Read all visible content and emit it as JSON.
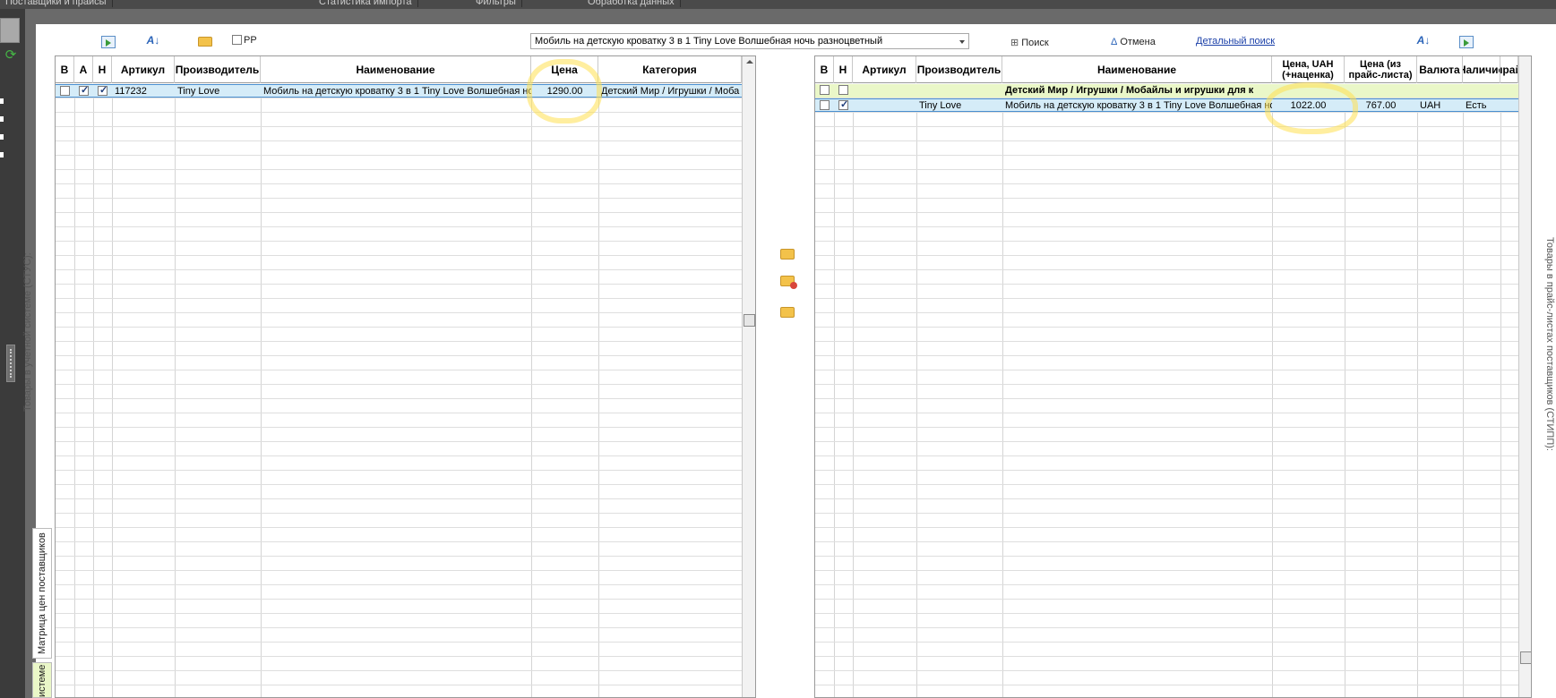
{
  "top_tabs": [
    "Поставщики и прайсы",
    "Статистика импорта",
    "Фильтры",
    "Обработка данных"
  ],
  "left_label": "Товары в учетной системе (СТУС):",
  "right_label": "Товары в прайс-листах поставщиков (СТИПП):",
  "bottom_tabs": [
    "Матрица цен поставщиков",
    "истеме"
  ],
  "toolbar": {
    "pp_label": "РР",
    "search_value": "Мобиль на детскую кроватку 3 в 1 Tiny Love Волшебная ночь разноцветный",
    "search_button": "Поиск",
    "cancel_button": "Отмена",
    "detail_search_link": "Детальный поиск"
  },
  "left_grid": {
    "headers": [
      "В",
      "А",
      "Н",
      "Артикул",
      "Производитель",
      "Наименование",
      "Цена",
      "Категория"
    ],
    "rows": [
      {
        "v": false,
        "a": true,
        "n": true,
        "article": "117232",
        "maker": "Tiny Love",
        "name": "Мобиль на детскую кроватку 3 в 1 Tiny Love Волшебная но",
        "price": "1290.00",
        "category": "Детский Мир / Игрушки / Моба"
      }
    ]
  },
  "right_grid": {
    "headers": [
      "В",
      "Н",
      "Артикул",
      "Производитель",
      "Наименование",
      "Цена, UAH (+наценка)",
      "Цена (из прайс-листа)",
      "Валюта",
      "Наличие",
      "прай"
    ],
    "group_row": "Детский Мир / Игрушки / Мобайлы и игрушки для к",
    "rows": [
      {
        "v": false,
        "n": true,
        "article": "",
        "maker": "Tiny Love",
        "name": "Мобиль на детскую кроватку 3 в 1 Tiny Love Волшебная но",
        "price_markup": "1022.00",
        "price_list": "767.00",
        "currency": "UAH",
        "availability": "Есть"
      }
    ]
  },
  "icons": {
    "export": "export-sheet-icon",
    "sort": "sort-az-icon",
    "open": "folder-open-icon",
    "search": "binoculars-icon",
    "cancel": "cancel-filter-icon"
  },
  "colors": {
    "selected_row": "#d5ecf8",
    "group_row": "#eaf7c8",
    "highlight": "#ffe050",
    "link": "#1a3fa8"
  }
}
